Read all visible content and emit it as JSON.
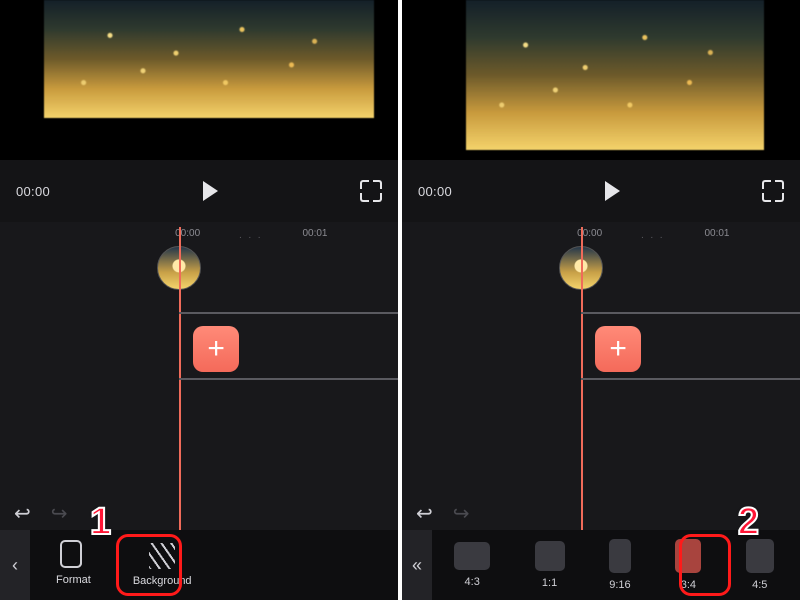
{
  "left": {
    "step_badge": "1",
    "time": "00:00",
    "ruler_t0": "00:00",
    "ruler_t1": "00:01",
    "toolbar": {
      "back_glyph": "‹",
      "format_label": "Format",
      "background_label": "Background"
    },
    "undo_glyph": "↩",
    "redo_glyph": "↪",
    "add_glyph": "+"
  },
  "right": {
    "step_badge": "2",
    "time": "00:00",
    "ruler_t0": "00:00",
    "ruler_t1": "00:01",
    "toolbar": {
      "back_glyph": "«"
    },
    "ratios": [
      {
        "label": "4:3",
        "selected": false,
        "w": 36,
        "h": 28
      },
      {
        "label": "1:1",
        "selected": false,
        "w": 30,
        "h": 30
      },
      {
        "label": "9:16",
        "selected": false,
        "w": 22,
        "h": 34
      },
      {
        "label": "3:4",
        "selected": true,
        "w": 26,
        "h": 34
      },
      {
        "label": "4:5",
        "selected": false,
        "w": 28,
        "h": 34
      }
    ],
    "undo_glyph": "↩",
    "redo_glyph": "↪",
    "add_glyph": "+"
  }
}
